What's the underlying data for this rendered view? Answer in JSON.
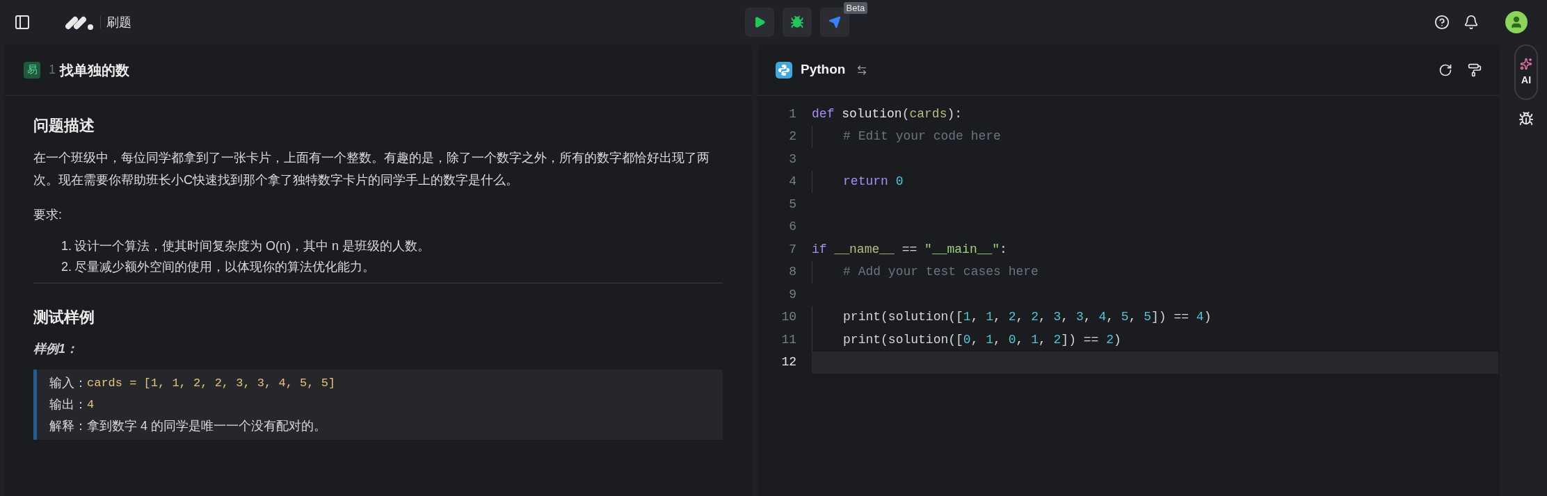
{
  "topbar": {
    "title": "刷题",
    "beta": "Beta"
  },
  "problem": {
    "difficulty": "易",
    "number": "1",
    "title": "找单独的数"
  },
  "description": {
    "heading": "问题描述",
    "paragraph": "在一个班级中，每位同学都拿到了一张卡片，上面有一个整数。有趣的是，除了一个数字之外，所有的数字都恰好出现了两次。现在需要你帮助班长小C快速找到那个拿了独特数字卡片的同学手上的数字是什么。",
    "requirements_label": "要求:",
    "requirements": [
      {
        "marker": "1.",
        "text": "设计一个算法，使其时间复杂度为 O(n)，其中 n 是班级的人数。"
      },
      {
        "marker": "2.",
        "text": "尽量减少额外空间的使用，以体现你的算法优化能力。"
      }
    ]
  },
  "samples": {
    "heading": "测试样例",
    "sample_title": "样例1：",
    "lines": [
      {
        "label": "输入：",
        "value": "cards = [1, 1, 2, 2, 3, 3, 4, 5, 5]",
        "kind": "code"
      },
      {
        "label": "输出：",
        "value": "4",
        "kind": "code"
      },
      {
        "label": "解释：",
        "value": "拿到数字 4 的同学是唯一一个没有配对的。",
        "kind": "text"
      }
    ]
  },
  "editor": {
    "language": "Python",
    "lines": [
      {
        "number": "1",
        "current": false,
        "indented": false,
        "tokens": [
          {
            "t": "def",
            "kind": "keyword"
          },
          {
            "t": " solution",
            "kind": "name"
          },
          {
            "t": "(",
            "kind": "plain"
          },
          {
            "t": "cards",
            "kind": "param"
          },
          {
            "t": "):",
            "kind": "plain"
          }
        ]
      },
      {
        "number": "2",
        "current": false,
        "indented": true,
        "tokens": [
          {
            "t": "# Edit your code here",
            "kind": "comment"
          }
        ]
      },
      {
        "number": "3",
        "current": false
      },
      {
        "number": "4",
        "current": false,
        "indented": true,
        "tokens": [
          {
            "t": "return",
            "kind": "keyword"
          },
          {
            "t": " 0",
            "kind": "number"
          }
        ]
      },
      {
        "number": "5",
        "current": false
      },
      {
        "number": "6",
        "current": false
      },
      {
        "number": "7",
        "current": false,
        "indented": false,
        "tokens": [
          {
            "t": "if",
            "kind": "keyword"
          },
          {
            "t": " __name__",
            "kind": "param"
          },
          {
            "t": " == ",
            "kind": "plain"
          },
          {
            "t": "\"__main__\"",
            "kind": "string"
          },
          {
            "t": ":",
            "kind": "plain"
          }
        ]
      },
      {
        "number": "8",
        "current": false,
        "indented": true,
        "tokens": [
          {
            "t": "# Add your test cases here",
            "kind": "comment"
          }
        ]
      },
      {
        "number": "9",
        "current": false
      },
      {
        "number": "10",
        "current": false,
        "indented": true,
        "tokens": [
          {
            "t": "print(solution([",
            "kind": "plain"
          },
          {
            "t": "1",
            "kind": "number"
          },
          {
            "t": ", ",
            "kind": "plain"
          },
          {
            "t": "1",
            "kind": "number"
          },
          {
            "t": ", ",
            "kind": "plain"
          },
          {
            "t": "2",
            "kind": "number"
          },
          {
            "t": ", ",
            "kind": "plain"
          },
          {
            "t": "2",
            "kind": "number"
          },
          {
            "t": ", ",
            "kind": "plain"
          },
          {
            "t": "3",
            "kind": "number"
          },
          {
            "t": ", ",
            "kind": "plain"
          },
          {
            "t": "3",
            "kind": "number"
          },
          {
            "t": ", ",
            "kind": "plain"
          },
          {
            "t": "4",
            "kind": "number"
          },
          {
            "t": ", ",
            "kind": "plain"
          },
          {
            "t": "5",
            "kind": "number"
          },
          {
            "t": ", ",
            "kind": "plain"
          },
          {
            "t": "5",
            "kind": "number"
          },
          {
            "t": "]) == ",
            "kind": "plain"
          },
          {
            "t": "4",
            "kind": "number"
          },
          {
            "t": ")",
            "kind": "plain"
          }
        ]
      },
      {
        "number": "11",
        "current": false,
        "indented": true,
        "tokens": [
          {
            "t": "print(solution([",
            "kind": "plain"
          },
          {
            "t": "0",
            "kind": "number"
          },
          {
            "t": ", ",
            "kind": "plain"
          },
          {
            "t": "1",
            "kind": "number"
          },
          {
            "t": ", ",
            "kind": "plain"
          },
          {
            "t": "0",
            "kind": "number"
          },
          {
            "t": ", ",
            "kind": "plain"
          },
          {
            "t": "1",
            "kind": "number"
          },
          {
            "t": ", ",
            "kind": "plain"
          },
          {
            "t": "2",
            "kind": "number"
          },
          {
            "t": "]) == ",
            "kind": "plain"
          },
          {
            "t": "2",
            "kind": "number"
          },
          {
            "t": ")",
            "kind": "plain"
          }
        ]
      },
      {
        "number": "12",
        "current": true
      }
    ]
  },
  "rail": {
    "ai_label": "AI"
  }
}
